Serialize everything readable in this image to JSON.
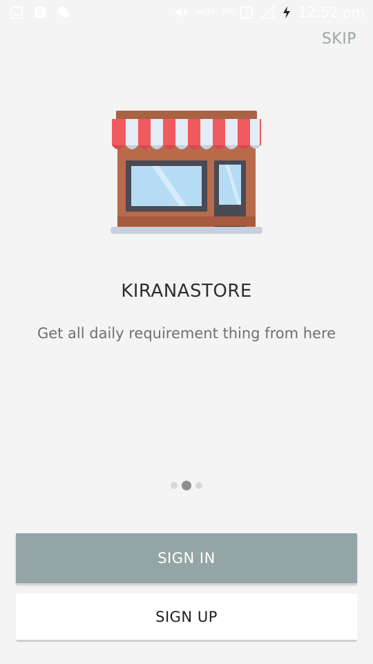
{
  "status_bar": {
    "time": "12:52 pm",
    "volte_label": "VoLTE",
    "lte_label": "LTE",
    "sim_label": "1",
    "icons": [
      "gallery-icon",
      "message-icon",
      "wechat-icon",
      "mute-icon",
      "signal-icon",
      "charging-icon"
    ]
  },
  "header": {
    "skip_label": "SKIP"
  },
  "onboarding": {
    "title": "KIRANASTORE",
    "subtitle": "Get all daily requirement thing from here",
    "page_count": 3,
    "active_page": 2
  },
  "actions": {
    "sign_in_label": "SIGN IN",
    "sign_up_label": "SIGN UP"
  },
  "colors": {
    "background": "#f4f4f4",
    "sign_in_bg": "#95a5a5",
    "skip_text": "#9aa6a6",
    "awning_red": "#f05a5e",
    "wall_brown": "#b86b4b"
  }
}
